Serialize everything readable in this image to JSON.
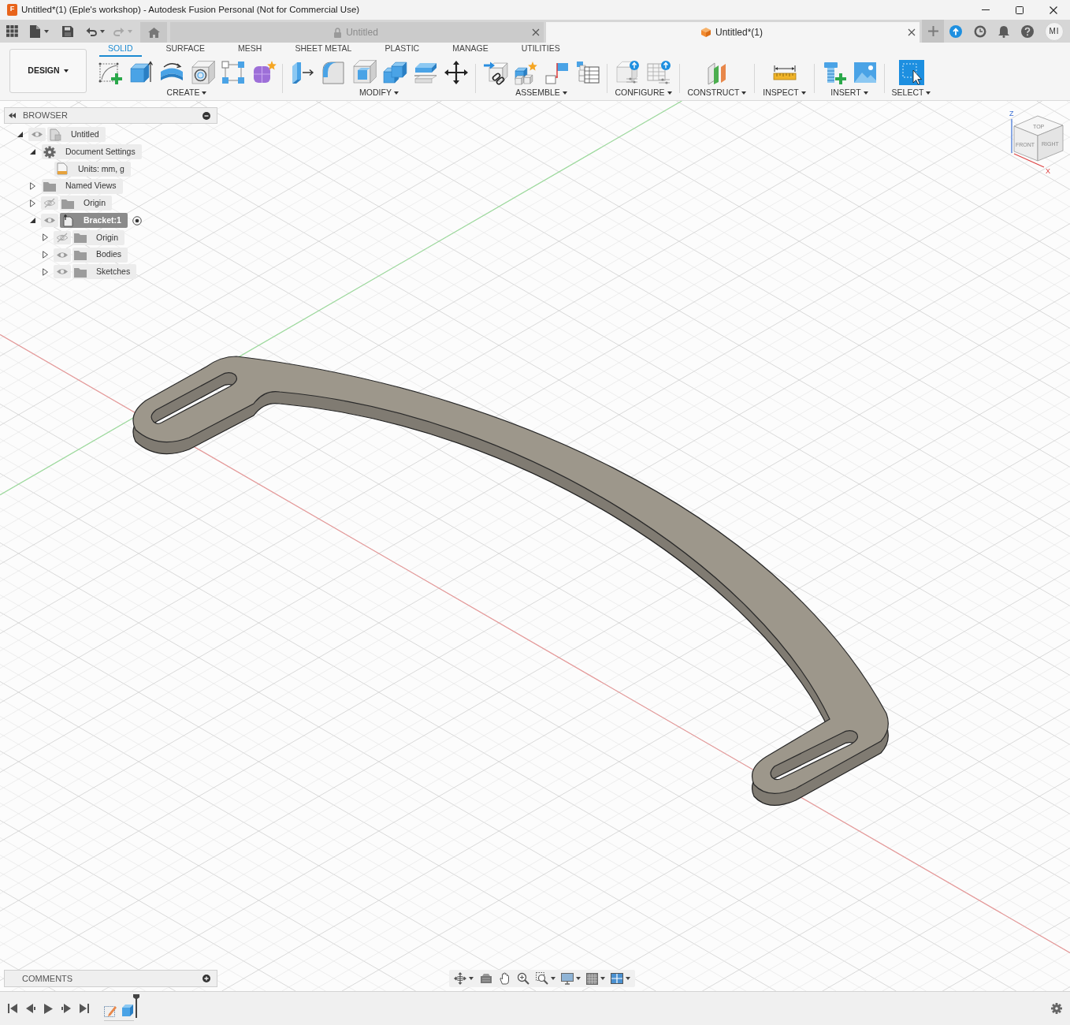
{
  "window": {
    "app_icon_letter": "F",
    "title": "Untitled*(1) (Eple's workshop) - Autodesk Fusion Personal (Not for Commercial Use)"
  },
  "quick_access": {
    "undo": {
      "disabled": false
    },
    "redo": {
      "disabled": true
    }
  },
  "document_tabs": [
    {
      "title": "Untitled",
      "kind": "locked",
      "selected": false
    },
    {
      "title": "Untitled*(1)",
      "kind": "design",
      "selected": true
    }
  ],
  "account": {
    "initials": "MI"
  },
  "toolbar": {
    "workspace": "DESIGN",
    "tabs": [
      {
        "label": "SOLID",
        "selected": true
      },
      {
        "label": "SURFACE",
        "selected": false
      },
      {
        "label": "MESH",
        "selected": false
      },
      {
        "label": "SHEET METAL",
        "selected": false
      },
      {
        "label": "PLASTIC",
        "selected": false
      },
      {
        "label": "MANAGE",
        "selected": false
      },
      {
        "label": "UTILITIES",
        "selected": false
      }
    ],
    "groups": [
      {
        "label": "CREATE"
      },
      {
        "label": "MODIFY"
      },
      {
        "label": "ASSEMBLE"
      },
      {
        "label": "CONFIGURE"
      },
      {
        "label": "CONSTRUCT"
      },
      {
        "label": "INSPECT"
      },
      {
        "label": "INSERT"
      },
      {
        "label": "SELECT"
      }
    ]
  },
  "browser": {
    "title": "BROWSER",
    "tree": [
      {
        "label": "Untitled",
        "kind": "document",
        "expanded": true,
        "visible": true,
        "selected": false,
        "active": false,
        "children": [
          {
            "label": "Document Settings",
            "kind": "settings",
            "expanded": true,
            "selected": false,
            "active": false,
            "children": [
              {
                "label": "Units: mm, g",
                "kind": "units",
                "selected": false,
                "active": false
              }
            ]
          },
          {
            "label": "Named Views",
            "kind": "folder",
            "expanded": false,
            "selected": false,
            "active": false
          },
          {
            "label": "Origin",
            "kind": "folder",
            "expanded": false,
            "visible": false,
            "selected": false,
            "active": false
          },
          {
            "label": "Bracket:1",
            "kind": "component",
            "expanded": true,
            "visible": true,
            "selected": true,
            "active": true,
            "children": [
              {
                "label": "Origin",
                "kind": "folder",
                "expanded": false,
                "visible": false,
                "selected": false,
                "active": false
              },
              {
                "label": "Bodies",
                "kind": "folder",
                "expanded": false,
                "visible": true,
                "selected": false,
                "active": false
              },
              {
                "label": "Sketches",
                "kind": "folder",
                "expanded": false,
                "visible": true,
                "selected": false,
                "active": false
              }
            ]
          }
        ]
      }
    ]
  },
  "view_cube": {
    "top": "TOP",
    "front": "FRONT",
    "right": "RIGHT",
    "axis_z": "Z",
    "axis_x": "X"
  },
  "comments": {
    "title": "COMMENTS"
  }
}
